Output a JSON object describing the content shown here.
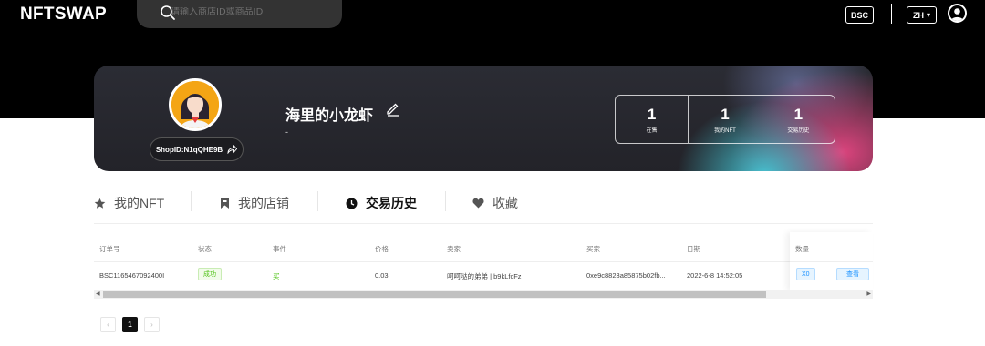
{
  "header": {
    "logo": "NFTSWAP",
    "search_placeholder": "请输入商店ID或商品ID",
    "chain": "BSC",
    "language": "ZH",
    "language_caret": "▾"
  },
  "shop": {
    "shop_id": "ShopID:N1qQHE9B",
    "name": "海里的小龙虾",
    "description": "-",
    "stats": [
      {
        "value": "1",
        "label": "在售"
      },
      {
        "value": "1",
        "label": "我的NFT"
      },
      {
        "value": "1",
        "label": "交易历史"
      }
    ]
  },
  "tabs": [
    {
      "label": "我的NFT",
      "icon": "star-icon"
    },
    {
      "label": "我的店铺",
      "icon": "bookmark-icon"
    },
    {
      "label": "交易历史",
      "icon": "clock-icon",
      "active": true
    },
    {
      "label": "收藏",
      "icon": "heart-icon"
    }
  ],
  "table": {
    "columns": [
      "订单号",
      "状态",
      "事件",
      "价格",
      "卖家",
      "买家",
      "日期",
      "数量"
    ],
    "rows": [
      {
        "order_no": "BSC1165467092400I",
        "status": "成功",
        "event": "买",
        "price": "0.03",
        "seller": "呵呵哒的弟弟 | b9kLfcFz",
        "buyer": "0xe9c8823a85875b02fb...",
        "date": "2022-6-8 14:52:05",
        "quantity": "X0",
        "action": "查看"
      }
    ]
  },
  "pagination": {
    "prev": "‹",
    "current": "1",
    "next": "›"
  },
  "colors": {
    "status_success": "#52c41a",
    "event_buy": "#52c41a",
    "action_blue": "#1890ff",
    "topbar": "#000000"
  }
}
